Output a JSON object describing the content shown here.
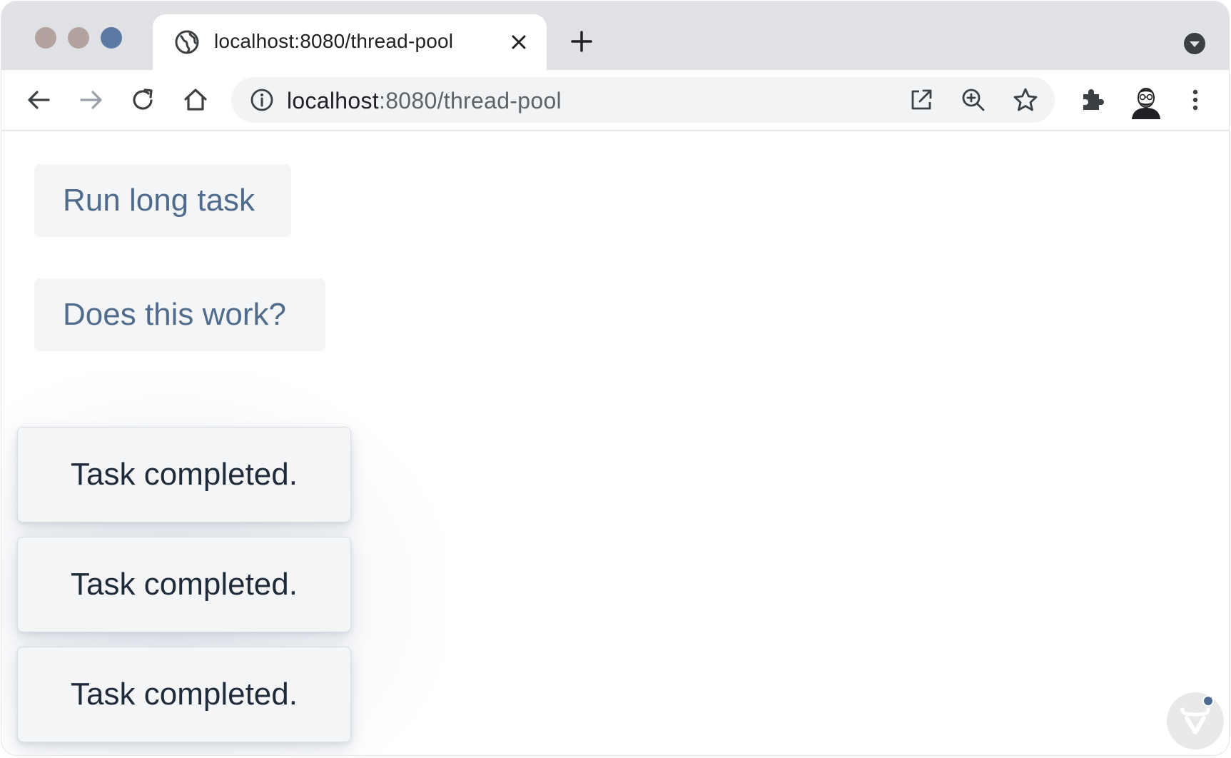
{
  "browser": {
    "tab": {
      "title": "localhost:8080/thread-pool",
      "favicon": "globe-icon"
    },
    "address_bar": {
      "host": "localhost",
      "path": ":8080/thread-pool"
    },
    "colors": {
      "traffic_light_1": "#b3a39f",
      "traffic_light_2": "#b3a39f",
      "traffic_light_3": "#5b7aa3"
    }
  },
  "page": {
    "buttons": {
      "run_long_task": "Run long task",
      "does_this_work": "Does this work?"
    },
    "notifications": [
      {
        "text": "Task completed."
      },
      {
        "text": "Task completed."
      },
      {
        "text": "Task completed."
      }
    ],
    "accent_color": "#516b8c"
  }
}
